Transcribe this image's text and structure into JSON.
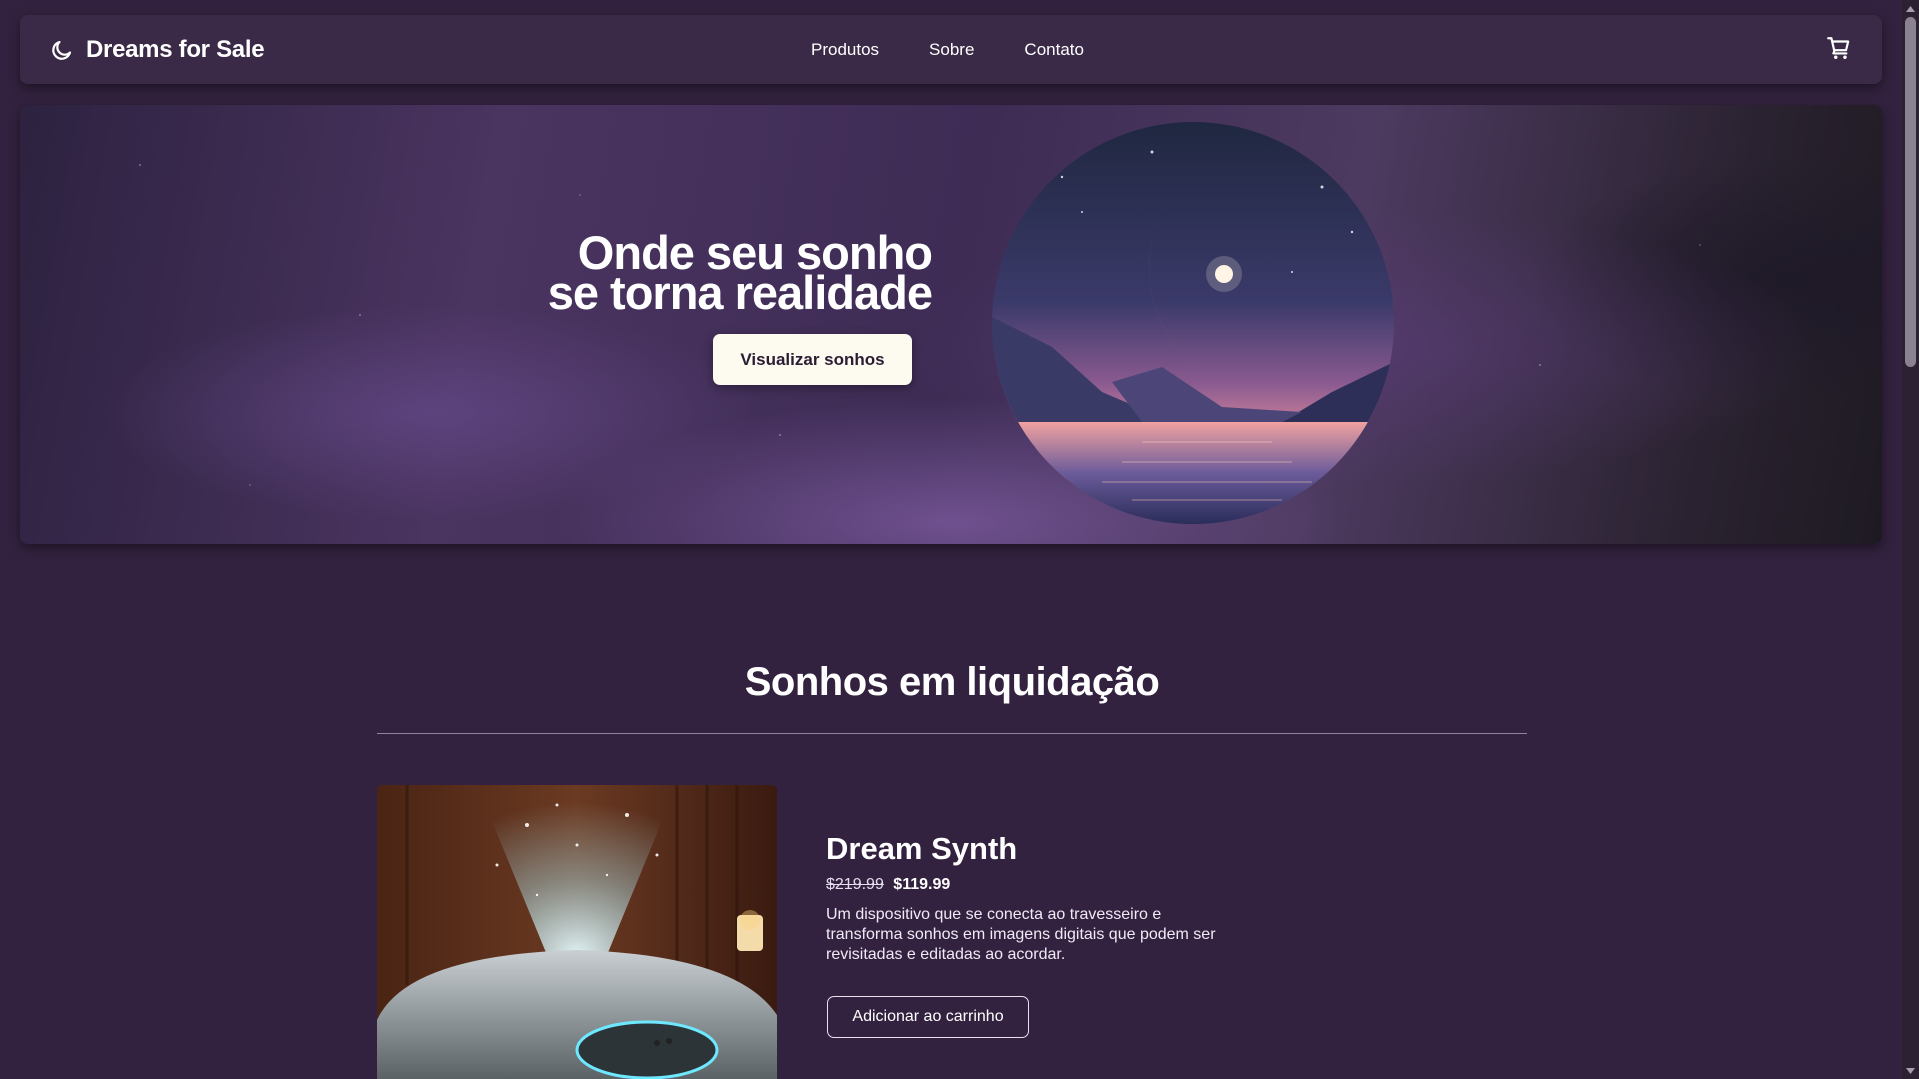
{
  "navbar": {
    "brand_name": "Dreams for Sale",
    "brand_icon": "moon-icon",
    "links": [
      "Produtos",
      "Sobre",
      "Contato"
    ],
    "cart_icon": "shopping-cart-icon"
  },
  "hero": {
    "title_line1": "Onde seu sonho",
    "title_line2": "se torna realidade",
    "cta_label": "Visualizar sonhos"
  },
  "section": {
    "title": "Sonhos em liquidação"
  },
  "product": {
    "name": "Dream Synth",
    "price_old": "$219.99",
    "price_new": "$119.99",
    "description": "Um dispositivo que se conecta ao travesseiro e transforma sonhos em imagens digitais que podem ser revisitadas e editadas ao acordar.",
    "add_to_cart_label": "Adicionar ao carrinho"
  },
  "colors": {
    "background": "#33223f",
    "navbar": "#3a2a47",
    "hero_button": "#fdfaf0",
    "text": "#ffffff"
  }
}
